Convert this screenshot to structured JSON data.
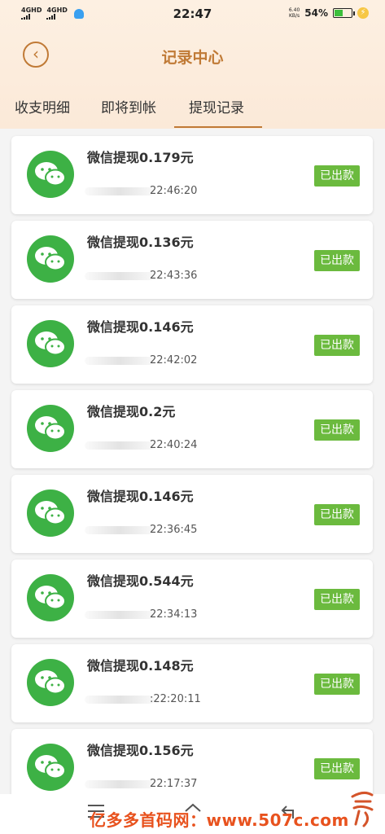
{
  "status_bar": {
    "network_1": "4GHD",
    "network_2": "4GHD",
    "time": "22:47",
    "speed_value": "6.40",
    "speed_unit": "KB/s",
    "battery_percent": "54%",
    "battery_level": 0.54,
    "icons": [
      "signal-icon",
      "bell-icon",
      "battery-icon",
      "charging-icon"
    ]
  },
  "header": {
    "title": "记录中心",
    "accent_color": "#c07a36"
  },
  "tabs": [
    {
      "label": "收支明细",
      "active": false
    },
    {
      "label": "即将到帐",
      "active": false
    },
    {
      "label": "提现记录",
      "active": true
    }
  ],
  "records": [
    {
      "title": "微信提现0.179元",
      "time": "22:46:20",
      "status": "已出款"
    },
    {
      "title": "微信提现0.136元",
      "time": "22:43:36",
      "status": "已出款"
    },
    {
      "title": "微信提现0.146元",
      "time": "22:42:02",
      "status": "已出款"
    },
    {
      "title": "微信提现0.2元",
      "time": "22:40:24",
      "status": "已出款"
    },
    {
      "title": "微信提现0.146元",
      "time": "22:36:45",
      "status": "已出款"
    },
    {
      "title": "微信提现0.544元",
      "time": "22:34:13",
      "status": "已出款"
    },
    {
      "title": "微信提现0.148元",
      "time": ":22:20:11",
      "status": "已出款"
    },
    {
      "title": "微信提现0.156元",
      "time": "22:17:37",
      "status": "已出款"
    }
  ],
  "colors": {
    "wechat_green": "#3db145",
    "badge_green": "#6bba3e"
  },
  "watermark": "亿多多首码网：www.507c.com"
}
